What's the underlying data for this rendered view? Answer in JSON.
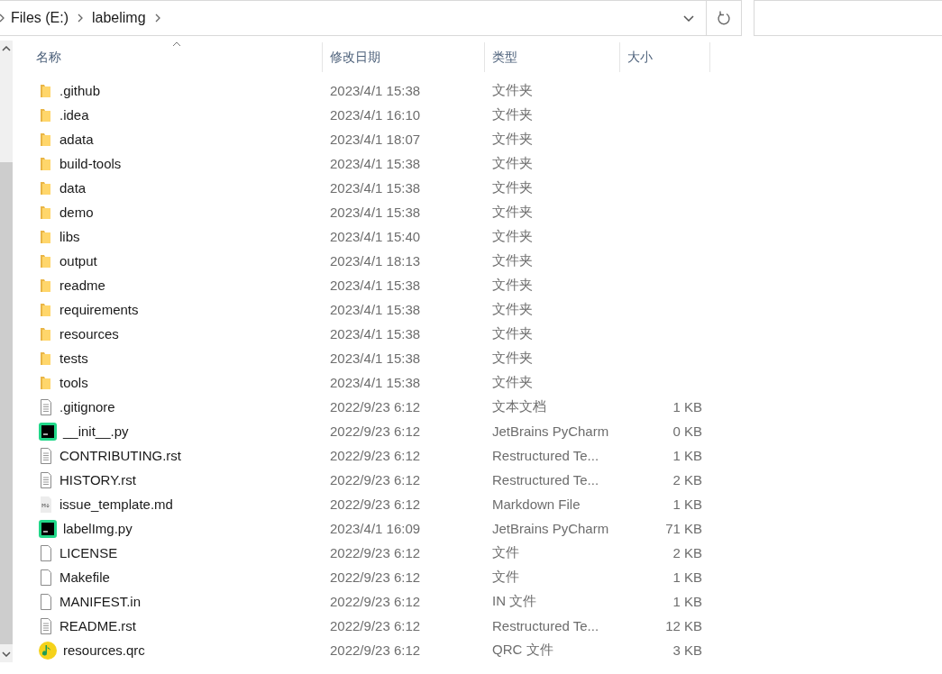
{
  "address_bar": {
    "breadcrumbs": [
      "Files (E:)",
      "labelimg"
    ]
  },
  "columns": [
    "名称",
    "修改日期",
    "类型",
    "大小"
  ],
  "files": [
    {
      "name": ".github",
      "date": "2023/4/1 15:38",
      "type": "文件夹",
      "kind": "folder"
    },
    {
      "name": ".idea",
      "date": "2023/4/1 16:10",
      "type": "文件夹",
      "kind": "folder"
    },
    {
      "name": "adata",
      "date": "2023/4/1 18:07",
      "type": "文件夹",
      "kind": "folder"
    },
    {
      "name": "build-tools",
      "date": "2023/4/1 15:38",
      "type": "文件夹",
      "kind": "folder"
    },
    {
      "name": "data",
      "date": "2023/4/1 15:38",
      "type": "文件夹",
      "kind": "folder"
    },
    {
      "name": "demo",
      "date": "2023/4/1 15:38",
      "type": "文件夹",
      "kind": "folder"
    },
    {
      "name": "libs",
      "date": "2023/4/1 15:40",
      "type": "文件夹",
      "kind": "folder"
    },
    {
      "name": "output",
      "date": "2023/4/1 18:13",
      "type": "文件夹",
      "kind": "folder"
    },
    {
      "name": "readme",
      "date": "2023/4/1 15:38",
      "type": "文件夹",
      "kind": "folder"
    },
    {
      "name": "requirements",
      "date": "2023/4/1 15:38",
      "type": "文件夹",
      "kind": "folder"
    },
    {
      "name": "resources",
      "date": "2023/4/1 15:38",
      "type": "文件夹",
      "kind": "folder"
    },
    {
      "name": "tests",
      "date": "2023/4/1 15:38",
      "type": "文件夹",
      "kind": "folder"
    },
    {
      "name": "tools",
      "date": "2023/4/1 15:38",
      "type": "文件夹",
      "kind": "folder"
    },
    {
      "name": ".gitignore",
      "date": "2022/9/23 6:12",
      "type": "文本文档",
      "size": "1 KB",
      "kind": "text"
    },
    {
      "name": "__init__.py",
      "date": "2022/9/23 6:12",
      "type": "JetBrains PyCharm",
      "size": "0 KB",
      "kind": "pycharm"
    },
    {
      "name": "CONTRIBUTING.rst",
      "date": "2022/9/23 6:12",
      "type": "Restructured Te...",
      "size": "1 KB",
      "kind": "text"
    },
    {
      "name": "HISTORY.rst",
      "date": "2022/9/23 6:12",
      "type": "Restructured Te...",
      "size": "2 KB",
      "kind": "text"
    },
    {
      "name": "issue_template.md",
      "date": "2022/9/23 6:12",
      "type": "Markdown File",
      "size": "1 KB",
      "kind": "markdown"
    },
    {
      "name": "labelImg.py",
      "date": "2023/4/1 16:09",
      "type": "JetBrains PyCharm",
      "size": "71 KB",
      "kind": "pycharm"
    },
    {
      "name": "LICENSE",
      "date": "2022/9/23 6:12",
      "type": "文件",
      "size": "2 KB",
      "kind": "blank"
    },
    {
      "name": "Makefile",
      "date": "2022/9/23 6:12",
      "type": "文件",
      "size": "1 KB",
      "kind": "blank"
    },
    {
      "name": "MANIFEST.in",
      "date": "2022/9/23 6:12",
      "type": "IN 文件",
      "size": "1 KB",
      "kind": "blank"
    },
    {
      "name": "README.rst",
      "date": "2022/9/23 6:12",
      "type": "Restructured Te...",
      "size": "12 KB",
      "kind": "text"
    },
    {
      "name": "resources.qrc",
      "date": "2022/9/23 6:12",
      "type": "QRC 文件",
      "size": "3 KB",
      "kind": "qrc"
    }
  ]
}
